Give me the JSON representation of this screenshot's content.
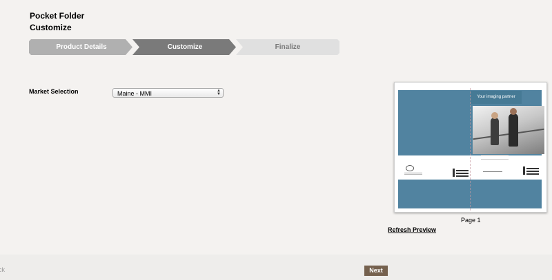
{
  "header": {
    "product": "Pocket Folder",
    "step_title": "Customize"
  },
  "steps": [
    {
      "label": "Product Details",
      "state": "completed"
    },
    {
      "label": "Customize",
      "state": "current"
    },
    {
      "label": "Finalize",
      "state": "upcoming"
    }
  ],
  "colors": {
    "step_completed": "#b0b0b0",
    "step_current": "#7a7a7a",
    "step_upcoming": "#e0e0e0",
    "next_button": "#75614e",
    "preview_blue": "#5183a0"
  },
  "market": {
    "label": "Market Selection",
    "selected": "Maine - MMI"
  },
  "preview": {
    "tagline": "Your imaging partner",
    "page_label": "Page 1",
    "refresh_label": "Refresh Preview"
  },
  "footer": {
    "back_label": "ck",
    "next_label": "Next"
  }
}
